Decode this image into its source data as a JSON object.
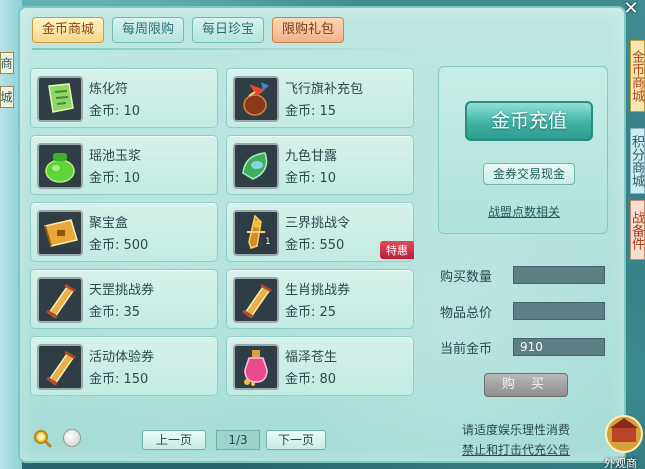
{
  "tabs": [
    {
      "label": "金币商城",
      "active": true
    },
    {
      "label": "每周限购"
    },
    {
      "label": "每日珍宝"
    },
    {
      "label": "限购礼包"
    }
  ],
  "items": [
    {
      "name": "炼化符",
      "price": "金币: 10",
      "icon": "talisman-icon"
    },
    {
      "name": "飞行旗补充包",
      "price": "金币: 15",
      "icon": "flag-pack-icon"
    },
    {
      "name": "瑶池玉浆",
      "price": "金币: 10",
      "icon": "jade-jar-icon"
    },
    {
      "name": "九色甘露",
      "price": "金币: 10",
      "icon": "dew-icon"
    },
    {
      "name": "聚宝盒",
      "price": "金币: 500",
      "icon": "treasure-box-icon"
    },
    {
      "name": "三界挑战令",
      "price": "金币: 550",
      "icon": "token-icon",
      "qty": "1",
      "badge": "特惠"
    },
    {
      "name": "天罡挑战券",
      "price": "金币: 35",
      "icon": "scroll-icon"
    },
    {
      "name": "生肖挑战券",
      "price": "金币: 25",
      "icon": "scroll-icon"
    },
    {
      "name": "活动体验券",
      "price": "金币: 150",
      "icon": "scroll-icon"
    },
    {
      "name": "福泽苍生",
      "price": "金币: 80",
      "icon": "potion-icon"
    }
  ],
  "right_panel": {
    "recharge_label": "金币充值",
    "exchange_label": "金券交易现金",
    "guild_label": "战盟点数相关"
  },
  "purchase": {
    "qty_label": "购买数量",
    "qty_value": "",
    "total_label": "物品总价",
    "total_value": "",
    "current_label": "当前金币",
    "current_value": "910",
    "buy_label": "购 买"
  },
  "pagination": {
    "prev_label": "上一页",
    "page": "1/3",
    "next_label": "下一页"
  },
  "notice": {
    "line1": "请适度娱乐理性消费",
    "line2": "禁止和打击代充公告"
  },
  "side_tabs": {
    "gold": "金币商城",
    "blue": "积分商城",
    "red": "战备件"
  },
  "left_tabs": {
    "top": "商",
    "bottom": "城"
  },
  "appearance_shop_label": "外观商",
  "close_label": "✕",
  "colors": {
    "panel": "#a6dcd6",
    "accent": "#3fb3a4",
    "badge": "#b81f36"
  }
}
